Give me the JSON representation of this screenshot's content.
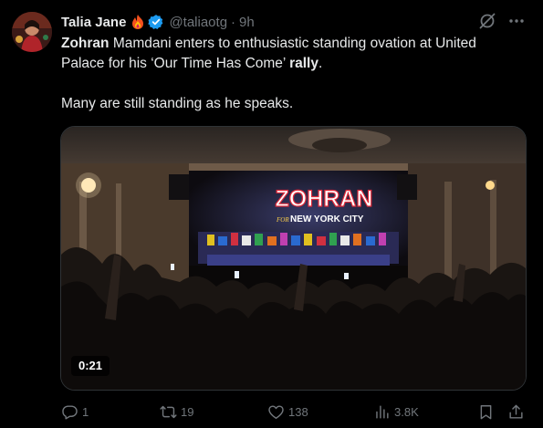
{
  "tweet": {
    "author_name": "Talia Jane",
    "handle": "@taliaotg",
    "separator": "·",
    "time": "9h",
    "text": {
      "bold1": "Zohran",
      "part1": " Mamdani enters to enthusiastic standing ovation at United Palace for his ‘Our Time Has Come’ ",
      "bold2": "rally",
      "part2": ".",
      "para2": "Many are still standing as he speaks."
    },
    "video": {
      "duration": "0:21",
      "sign_main": "ZOHRAN",
      "sign_sub_for": "FOR",
      "sign_sub_city": "NEW YORK CITY"
    },
    "stats": {
      "replies": "1",
      "reposts": "19",
      "likes": "138",
      "views": "3.8K"
    }
  },
  "colors": {
    "background": "#000000",
    "text": "#e7e9ea",
    "muted": "#71767b",
    "verified": "#1d9bf0"
  },
  "icons": [
    "fire-emoji-icon",
    "verified-badge-icon",
    "grok-icon",
    "more-icon",
    "reply-icon",
    "retweet-icon",
    "like-icon",
    "views-icon",
    "bookmark-icon",
    "share-icon"
  ]
}
